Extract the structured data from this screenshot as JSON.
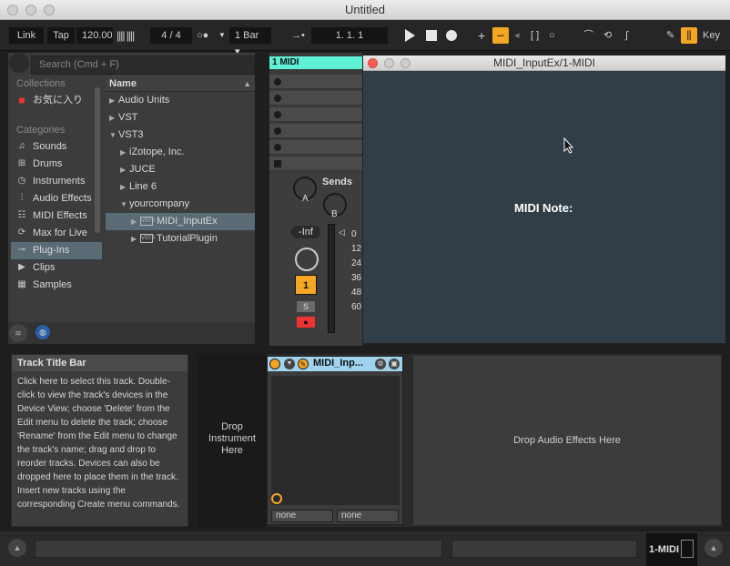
{
  "window": {
    "title": "Untitled"
  },
  "control_bar": {
    "link_label": "Link",
    "tap_label": "Tap",
    "tempo": "120.00",
    "time_signature": "4 / 4",
    "quantize": "1 Bar",
    "position": "1.   1.   1",
    "key_label": "Key"
  },
  "browser": {
    "search_placeholder": "Search (Cmd + F)",
    "collections_header": "Collections",
    "favorites_label": "お気に入り",
    "categories_header": "Categories",
    "categories": [
      "Sounds",
      "Drums",
      "Instruments",
      "Audio Effects",
      "MIDI Effects",
      "Max for Live",
      "Plug-Ins",
      "Clips",
      "Samples"
    ],
    "name_header": "Name",
    "tree": [
      "Audio Units",
      "VST",
      "VST3",
      "iZotope, Inc.",
      "JUCE",
      "Line 6",
      "yourcompany",
      "MIDI_InputEx",
      "TutorialPlugin"
    ],
    "vst_badge": "VST3"
  },
  "session": {
    "track_name": "1 MIDI",
    "sends_label": "Sends",
    "send_a": "A",
    "send_b": "B",
    "volume": "-Inf",
    "track_number": "1",
    "solo_label": "S",
    "meter_ticks": [
      "0",
      "12",
      "24",
      "36",
      "48",
      "60"
    ]
  },
  "plugin_window": {
    "title": "MIDI_InputEx/1-MIDI",
    "midi_note_label": "MIDI Note:"
  },
  "info_view": {
    "title": "Track Title Bar",
    "text": "Click here to select this track. Double-click to view the track's devices in the Device View; choose 'Delete' from the Edit menu to delete the track; choose 'Rename' from the Edit menu to change the track's name; drag and drop to reorder tracks. Devices can also be dropped here to place them in the track. Insert new tracks using the corresponding Create menu commands."
  },
  "device_chain": {
    "drop_instrument": "Drop Instrument Here",
    "device_name": "MIDI_Inp...",
    "select_left": "none",
    "select_right": "none",
    "drop_audio": "Drop Audio Effects Here"
  },
  "status_bar": {
    "track_label": "1-MIDI"
  },
  "colors": {
    "accent": "#f5a623",
    "track_color": "#5ff0d6",
    "device_header": "#9fd3ee"
  }
}
